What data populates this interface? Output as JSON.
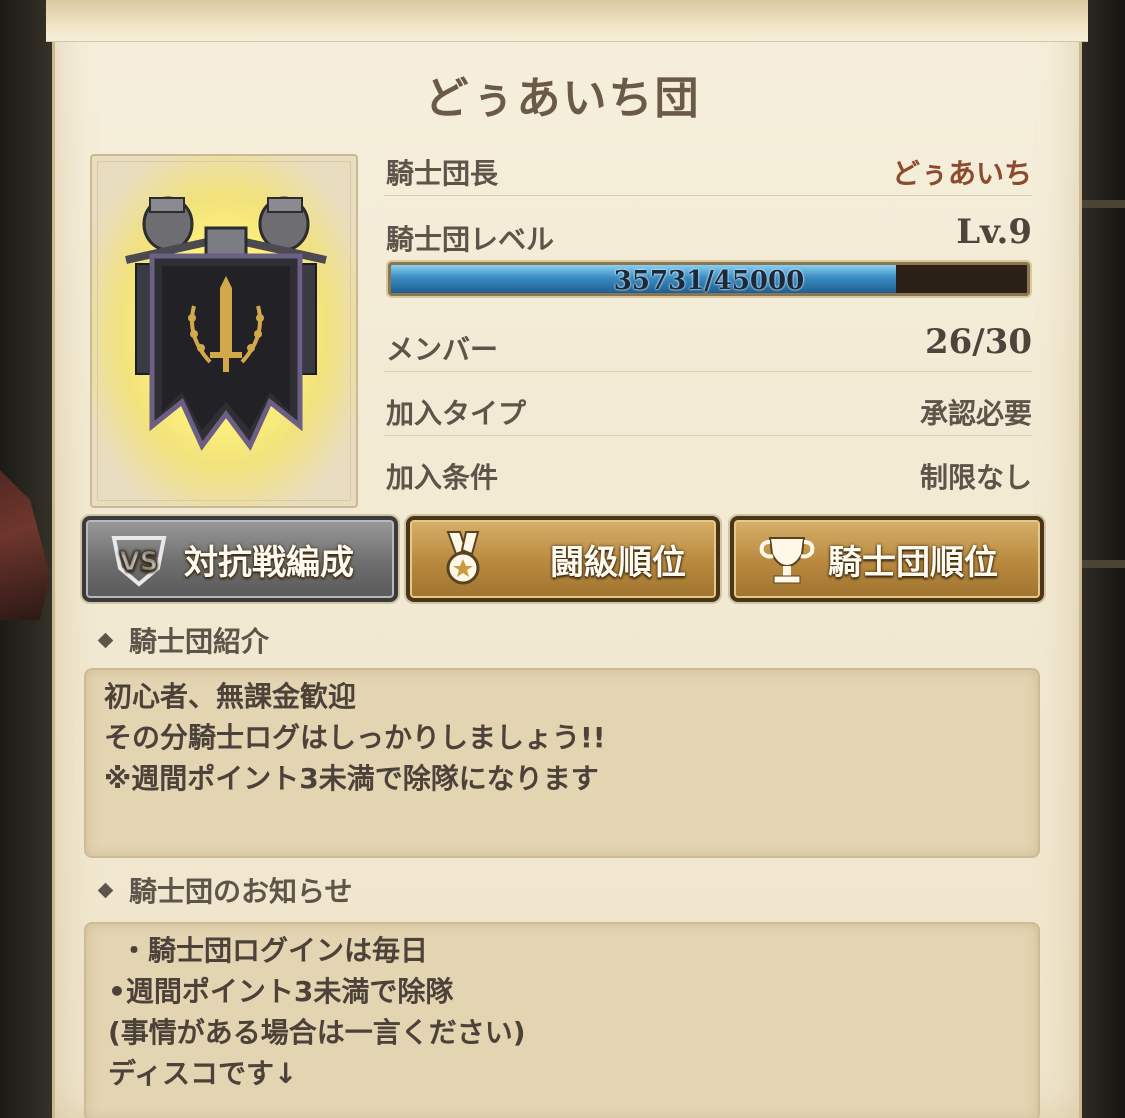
{
  "title": "どぅあいち団",
  "info": {
    "leader_label": "騎士団長",
    "leader_value": "どぅあいち",
    "level_label": "騎士団レベル",
    "level_value": "Lv.9",
    "exp_text": "35731/45000",
    "exp_progress": 0.794,
    "members_label": "メンバー",
    "members_value": "26/30",
    "join_type_label": "加入タイプ",
    "join_type_value": "承認必要",
    "join_condition_label": "加入条件",
    "join_condition_value": "制限なし"
  },
  "buttons": {
    "versus": {
      "label": "対抗戦編成",
      "icon": "vs-icon"
    },
    "rank": {
      "label": "闘級順位",
      "icon": "medal-icon"
    },
    "knight_rank": {
      "label": "騎士団順位",
      "icon": "trophy-icon"
    }
  },
  "intro": {
    "heading": "騎士団紹介",
    "lines": [
      "初心者、無課金歓迎",
      "その分騎士ログはしっかりしましょう!!",
      "※週間ポイント3未満で除隊になります"
    ]
  },
  "notice": {
    "heading": "騎士団のお知らせ",
    "lines": [
      "・騎士団ログインは毎日",
      "•週間ポイント3未満で除隊",
      "(事情がある場合は一言ください)",
      "ディスコです↓"
    ]
  },
  "colors": {
    "parchment": "#f2ead3",
    "gold_button": "#b8893f",
    "gray_button": "#6e6e6e",
    "exp_blue": "#3a8cc2",
    "leader_text": "#8c4a2e"
  }
}
